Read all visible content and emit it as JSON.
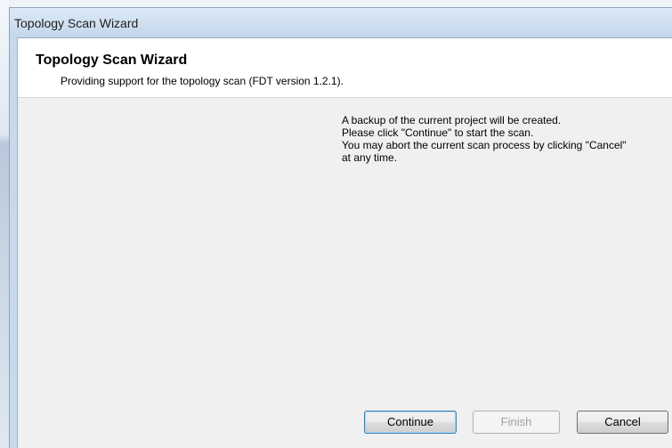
{
  "window": {
    "title": "Topology Scan Wizard"
  },
  "header": {
    "title": "Topology Scan Wizard",
    "subtitle": "Providing support for the topology scan (FDT version 1.2.1)."
  },
  "message": {
    "lines": [
      "A backup of the current project will be created.",
      "Please click \"Continue\" to start the scan.",
      "You may abort the current scan process by clicking \"Cancel\"",
      "at any time."
    ]
  },
  "buttons": {
    "continue_label": "Continue",
    "finish_label": "Finish",
    "cancel_label": "Cancel"
  },
  "colors": {
    "default_button_border": "#3c7fb1",
    "disabled_text": "#a0a0a0",
    "header_background": "#ffffff",
    "content_background": "#f0f0f0"
  }
}
